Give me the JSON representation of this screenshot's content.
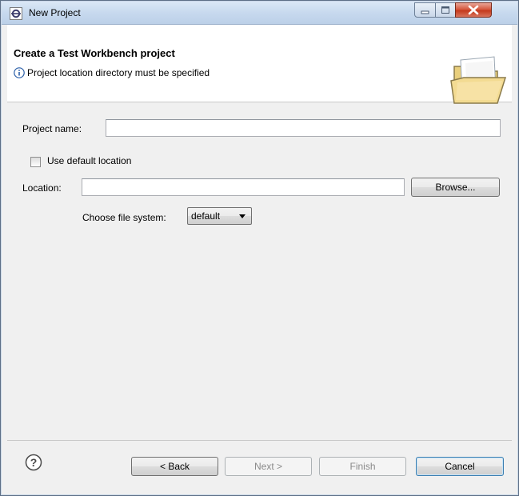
{
  "window": {
    "title": "New Project",
    "minimize_icon": "minimize-icon",
    "maximize_icon": "maximize-icon",
    "close_icon": "close-icon"
  },
  "header": {
    "title": "Create a Test Workbench project",
    "message": "Project location directory must be specified",
    "message_icon": "info-icon",
    "banner_icon": "folder-icon"
  },
  "form": {
    "project_name_label": "Project name:",
    "project_name_value": "",
    "use_default_location_label": "Use default location",
    "use_default_location_checked": false,
    "location_label": "Location:",
    "location_value": "",
    "browse_label": "Browse...",
    "file_system_label": "Choose file system:",
    "file_system_value": "default"
  },
  "footer": {
    "help_icon": "help-icon",
    "back_label": "< Back",
    "next_label": "Next >",
    "finish_label": "Finish",
    "cancel_label": "Cancel"
  }
}
